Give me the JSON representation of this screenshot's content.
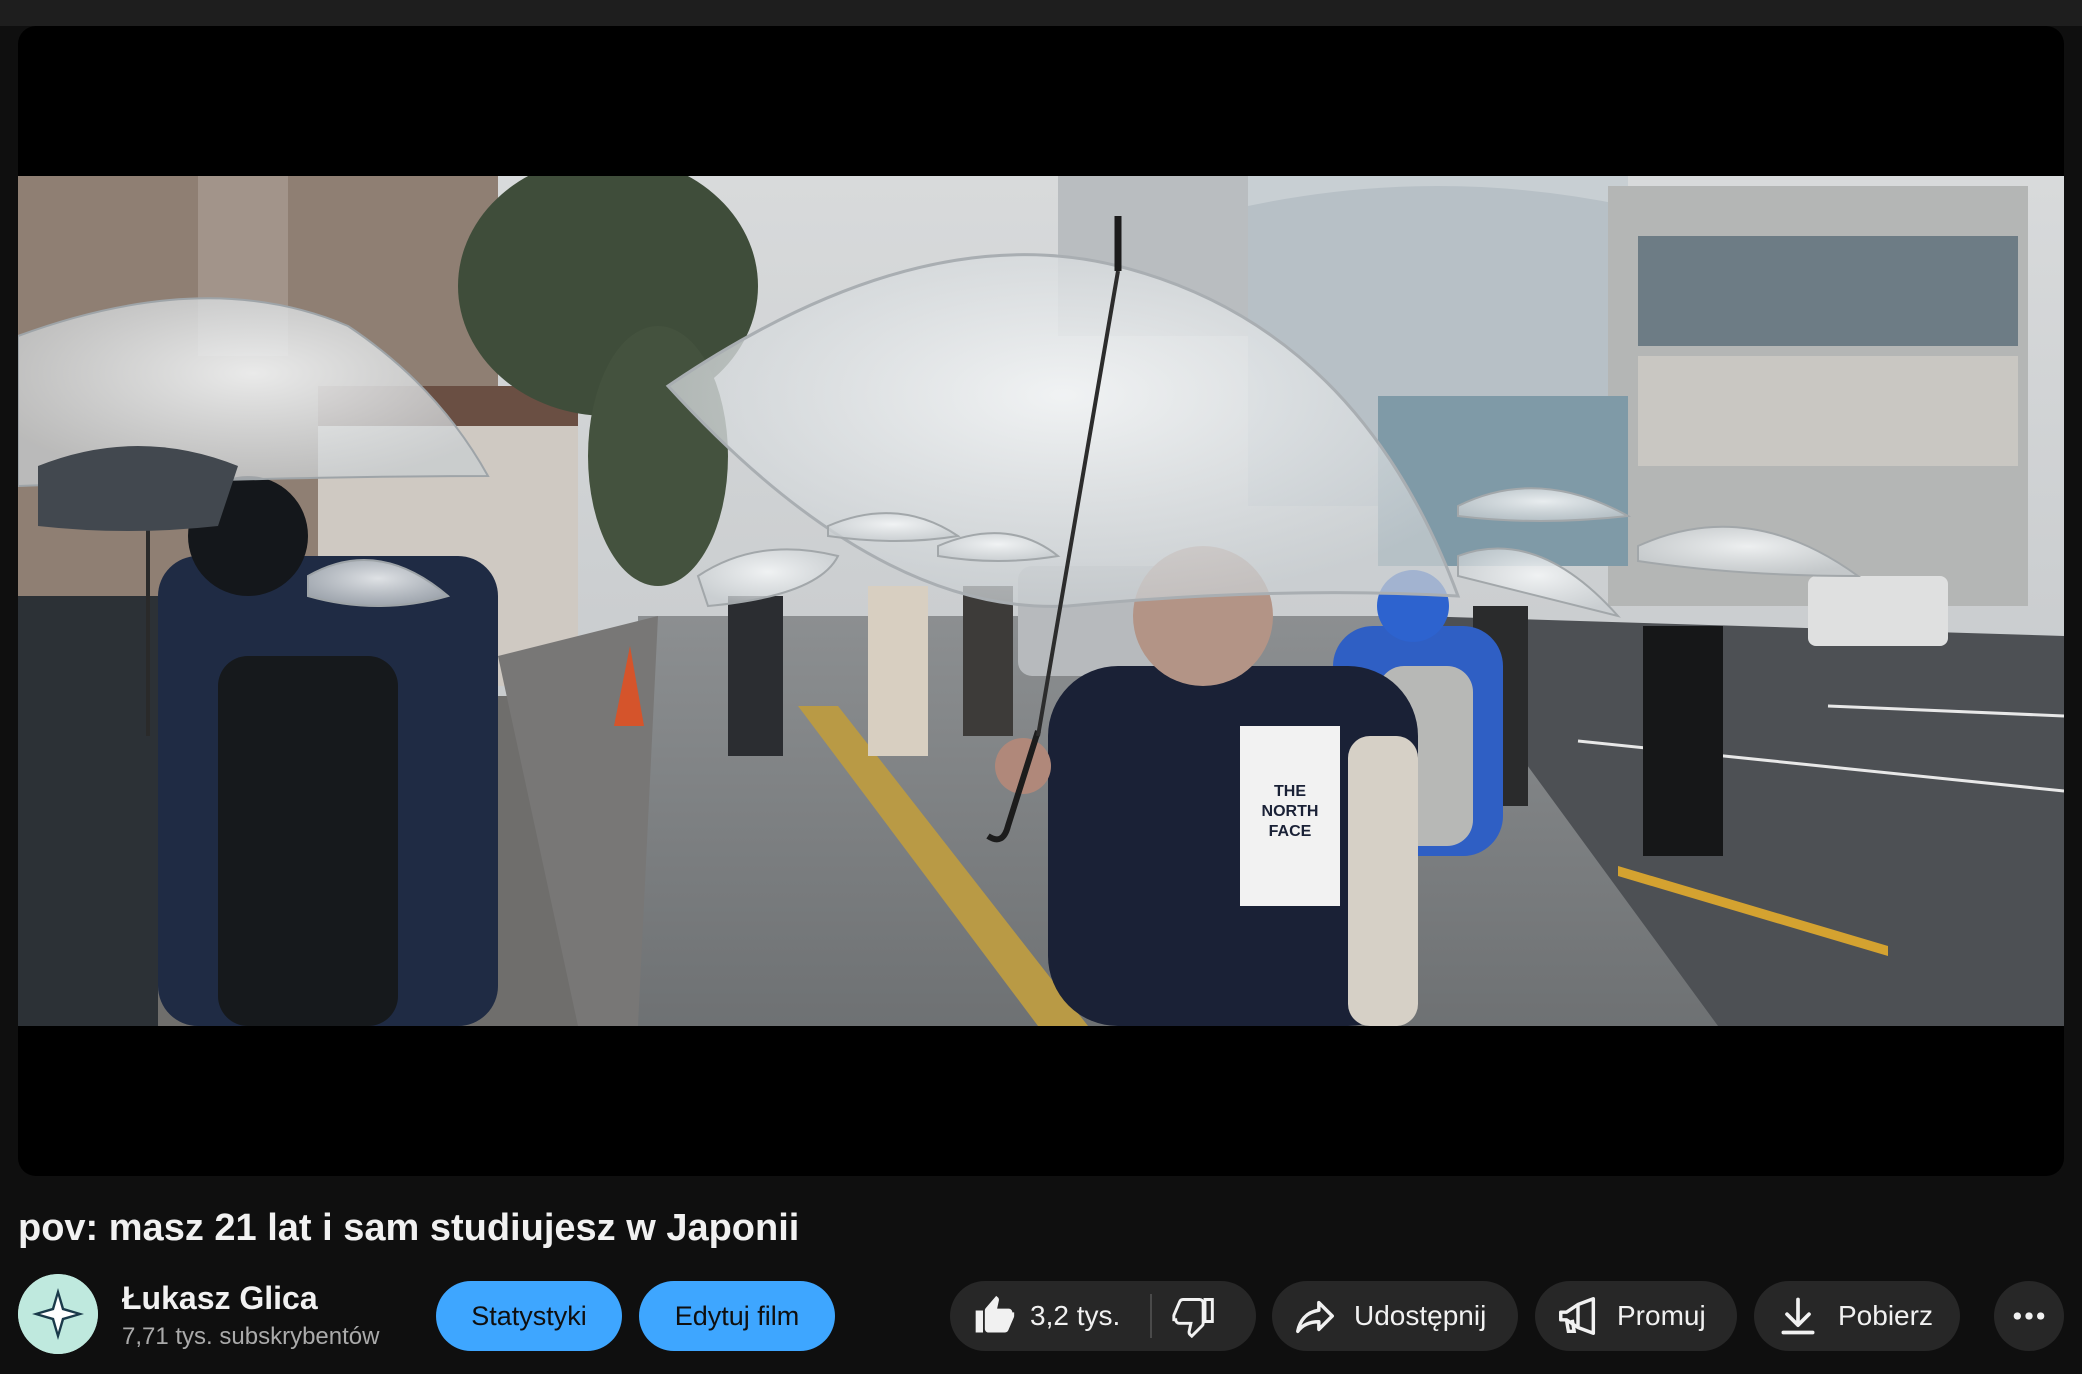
{
  "video": {
    "title": "pov: masz 21 lat i sam studiujesz w Japonii"
  },
  "channel": {
    "name": "Łukasz Glica",
    "subscribers": "7,71 tys. subskrybentów"
  },
  "actions": {
    "stats_label": "Statystyki",
    "edit_label": "Edytuj film",
    "like_count": "3,2 tys.",
    "share_label": "Udostępnij",
    "promote_label": "Promuj",
    "download_label": "Pobierz"
  },
  "icons": {
    "like": "thumbs-up-icon",
    "dislike": "thumbs-down-icon",
    "share": "share-arrow-icon",
    "promote": "megaphone-icon",
    "download": "download-icon",
    "more": "more-horizontal-icon"
  },
  "colors": {
    "background": "#0f0f0f",
    "accent_blue": "#3ea6ff",
    "pill_dark": "#272727",
    "secondary_text": "#aaaaaa"
  }
}
